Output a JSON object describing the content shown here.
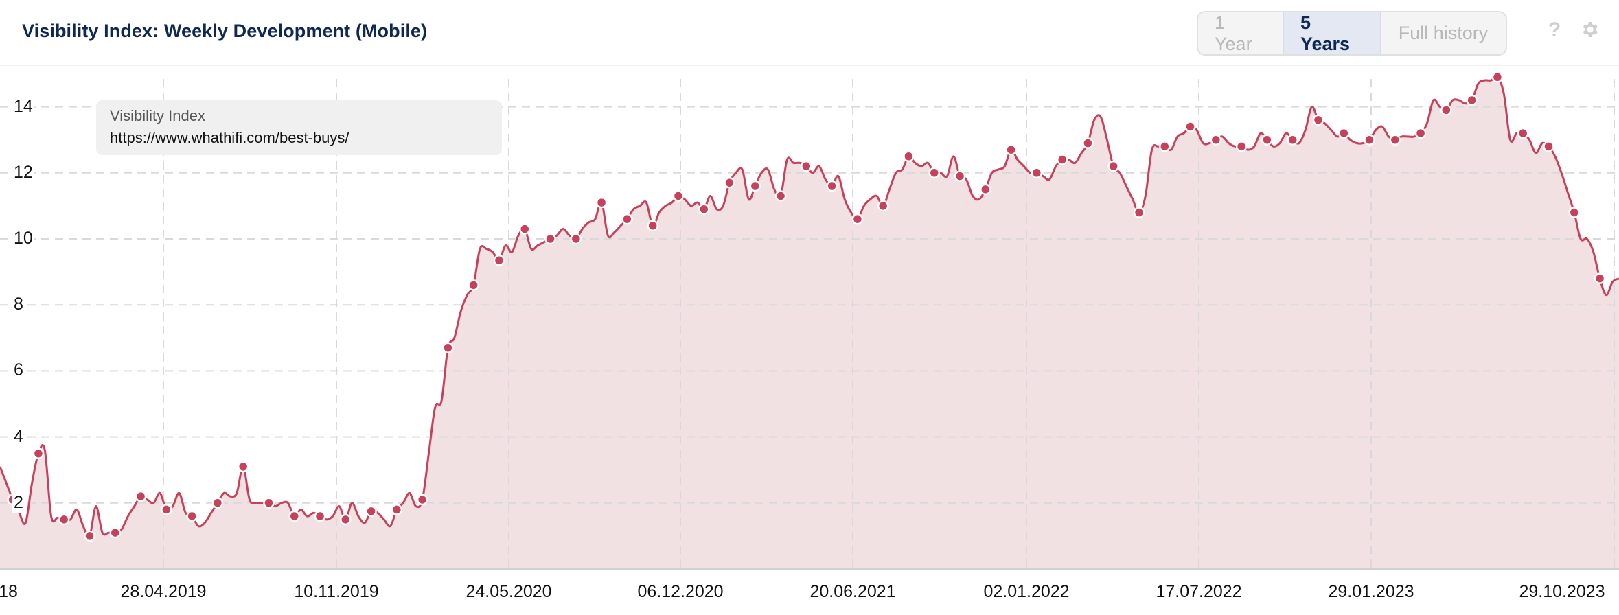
{
  "header": {
    "title": "Visibility Index: Weekly Development (Mobile)",
    "range_buttons": [
      {
        "label": "1 Year",
        "active": false
      },
      {
        "label": "5 Years",
        "active": true
      },
      {
        "label": "Full history",
        "active": false
      }
    ],
    "help_icon": "question-mark-icon",
    "settings_icon": "gear-icon"
  },
  "legend": {
    "title": "Visibility Index",
    "url": "https://www.whathifi.com/best-buys/"
  },
  "colors": {
    "line": "#c8415a",
    "fill": "#f1dfe2",
    "title": "#0e2856",
    "active_button_bg": "#e3e8f2"
  },
  "chart_data": {
    "type": "area",
    "title": "Visibility Index: Weekly Development (Mobile)",
    "xlabel": "",
    "ylabel": "",
    "ylim": [
      0,
      15
    ],
    "yticks": [
      2,
      4,
      6,
      8,
      10,
      12,
      14
    ],
    "xtick_labels": [
      "18",
      "28.04.2019",
      "10.11.2019",
      "24.05.2020",
      "06.12.2020",
      "20.06.2021",
      "02.01.2022",
      "17.07.2022",
      "29.01.2023",
      "29.10.2023"
    ],
    "grid": true,
    "legend_position": "top-left",
    "series": [
      {
        "name": "https://www.whathifi.com/best-buys/",
        "weekly_values": [
          3.1,
          2.6,
          2.1,
          1.7,
          1.4,
          2.6,
          3.5,
          3.6,
          1.6,
          1.55,
          1.5,
          1.5,
          1.8,
          1.3,
          1.0,
          1.9,
          1.1,
          1.1,
          1.1,
          1.2,
          1.6,
          1.9,
          2.2,
          2.1,
          2.0,
          2.3,
          1.8,
          1.9,
          2.3,
          1.7,
          1.6,
          1.3,
          1.4,
          1.7,
          2.0,
          2.3,
          2.2,
          2.3,
          3.1,
          2.1,
          2.0,
          2.0,
          2.0,
          1.9,
          2.0,
          2.0,
          1.6,
          1.8,
          1.6,
          1.7,
          1.6,
          1.5,
          1.6,
          1.9,
          1.5,
          2.0,
          1.6,
          1.4,
          1.75,
          1.7,
          1.5,
          1.3,
          1.8,
          2.0,
          2.3,
          1.9,
          2.1,
          3.5,
          4.9,
          5.1,
          6.7,
          7.0,
          7.8,
          8.3,
          8.6,
          9.7,
          9.7,
          9.6,
          9.35,
          9.8,
          9.6,
          10.1,
          10.3,
          9.7,
          9.8,
          9.9,
          10.0,
          10.1,
          10.3,
          10.1,
          10.0,
          10.3,
          10.5,
          10.6,
          11.1,
          10.1,
          10.2,
          10.4,
          10.6,
          10.9,
          11.0,
          11.1,
          10.4,
          10.8,
          11.0,
          11.1,
          11.3,
          11.2,
          11.0,
          11.1,
          10.9,
          11.3,
          10.9,
          11.0,
          11.7,
          12.0,
          12.1,
          11.2,
          11.6,
          12.0,
          12.1,
          11.5,
          11.3,
          12.4,
          12.3,
          12.3,
          12.2,
          12.0,
          12.2,
          11.8,
          11.6,
          11.9,
          11.2,
          10.8,
          10.6,
          11.0,
          11.2,
          11.3,
          11.0,
          11.5,
          12.0,
          12.1,
          12.5,
          12.3,
          12.2,
          12.3,
          12.0,
          12.0,
          11.9,
          12.5,
          11.9,
          11.8,
          11.3,
          11.2,
          11.5,
          12.0,
          12.1,
          12.2,
          12.7,
          12.4,
          12.2,
          12.0,
          12.0,
          11.9,
          11.8,
          12.2,
          12.4,
          12.4,
          12.3,
          12.6,
          12.9,
          13.6,
          13.7,
          13.0,
          12.2,
          12.0,
          11.6,
          11.2,
          10.8,
          11.3,
          12.7,
          12.8,
          12.8,
          12.7,
          13.1,
          13.2,
          13.4,
          13.3,
          12.9,
          12.9,
          13.0,
          13.1,
          12.9,
          12.8,
          12.8,
          12.7,
          12.8,
          13.2,
          13.0,
          12.8,
          12.9,
          13.2,
          13.0,
          12.9,
          13.3,
          14.0,
          13.6,
          13.5,
          13.3,
          13.1,
          13.2,
          13.0,
          12.9,
          12.9,
          13.0,
          13.3,
          13.4,
          13.1,
          13.0,
          13.1,
          13.1,
          13.1,
          13.2,
          13.5,
          14.2,
          14.0,
          13.9,
          14.2,
          14.2,
          14.1,
          14.2,
          14.7,
          14.8,
          14.8,
          14.9,
          14.4,
          13.0,
          13.2,
          13.2,
          13.0,
          12.6,
          12.9,
          12.8,
          12.5,
          12.0,
          11.4,
          10.8,
          10.0,
          10.0,
          9.6,
          8.8,
          8.3,
          8.7,
          8.8
        ],
        "marker_every_weeks": 4,
        "marker_offset_weeks": 2
      }
    ]
  }
}
